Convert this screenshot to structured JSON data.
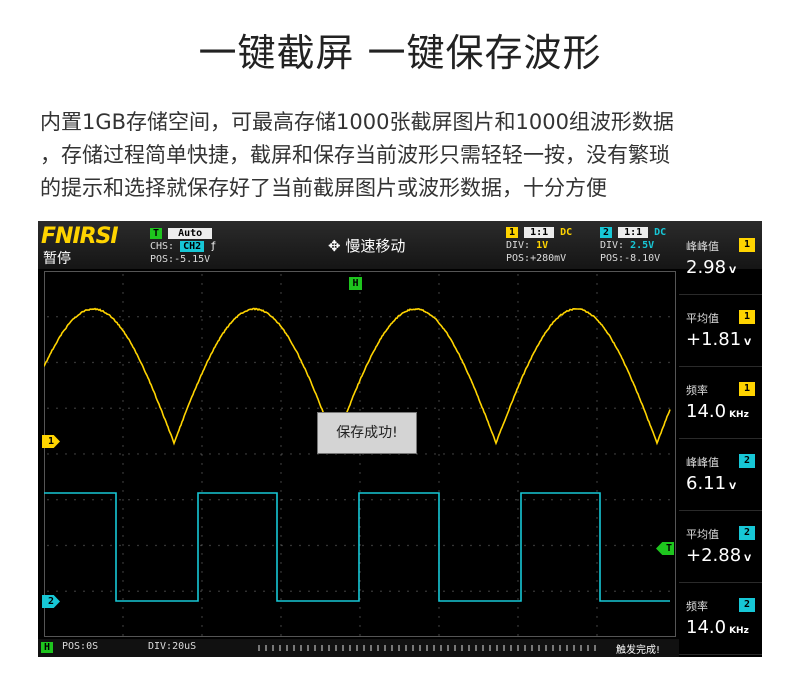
{
  "headline": "一键截屏  一键保存波形",
  "description": {
    "line1": "内置1GB存储空间，可最高存储1000张截屏图片和1000组波形数据",
    "line2": "，存储过程简单快捷，截屏和保存当前波形只需轻轻一按，没有繁琐",
    "line3": "的提示和选择就保存好了当前截屏图片或波形数据，十分方便"
  },
  "scope": {
    "brand": "FNIRSI",
    "run_state": "暂停",
    "trigger": {
      "badge": "T",
      "mode": "Auto",
      "chs_label": "CHS:",
      "chs_value": "CH2",
      "edge_icon": "ƒ",
      "pos": "POS:-5.15V"
    },
    "mode_icon": "✥",
    "mode_text": "慢速移动",
    "ch1": {
      "badge": "1",
      "probe": "1:1",
      "coupling": "DC",
      "div_label": "DIV:",
      "div_value": "1V",
      "pos": "POS:+280mV"
    },
    "ch2": {
      "badge": "2",
      "probe": "1:1",
      "coupling": "DC",
      "div_label": "DIV:",
      "div_value": "2.5V",
      "pos": "POS:-8.10V"
    },
    "markers": {
      "h": "H",
      "ch1": "1",
      "ch2": "2",
      "trigger": "T"
    },
    "toast": "保存成功!",
    "measurements": [
      {
        "name": "峰峰值",
        "channel": "1",
        "value": "2.98",
        "unit": "V"
      },
      {
        "name": "平均值",
        "channel": "1",
        "value": "+1.81",
        "unit": "V"
      },
      {
        "name": "频率",
        "channel": "1",
        "value": "14.0",
        "unit": "KHz"
      },
      {
        "name": "峰峰值",
        "channel": "2",
        "value": "6.11",
        "unit": "V"
      },
      {
        "name": "平均值",
        "channel": "2",
        "value": "+2.88",
        "unit": "V"
      },
      {
        "name": "频率",
        "channel": "2",
        "value": "14.0",
        "unit": "KHz"
      }
    ],
    "bottom": {
      "h_badge": "H",
      "pos": "POS:0S",
      "div": "DIV:20uS",
      "status": "触发完成!"
    },
    "colors": {
      "ch1": "#ffd400",
      "ch2": "#17c7d6",
      "trigger": "#1ec51e"
    }
  }
}
